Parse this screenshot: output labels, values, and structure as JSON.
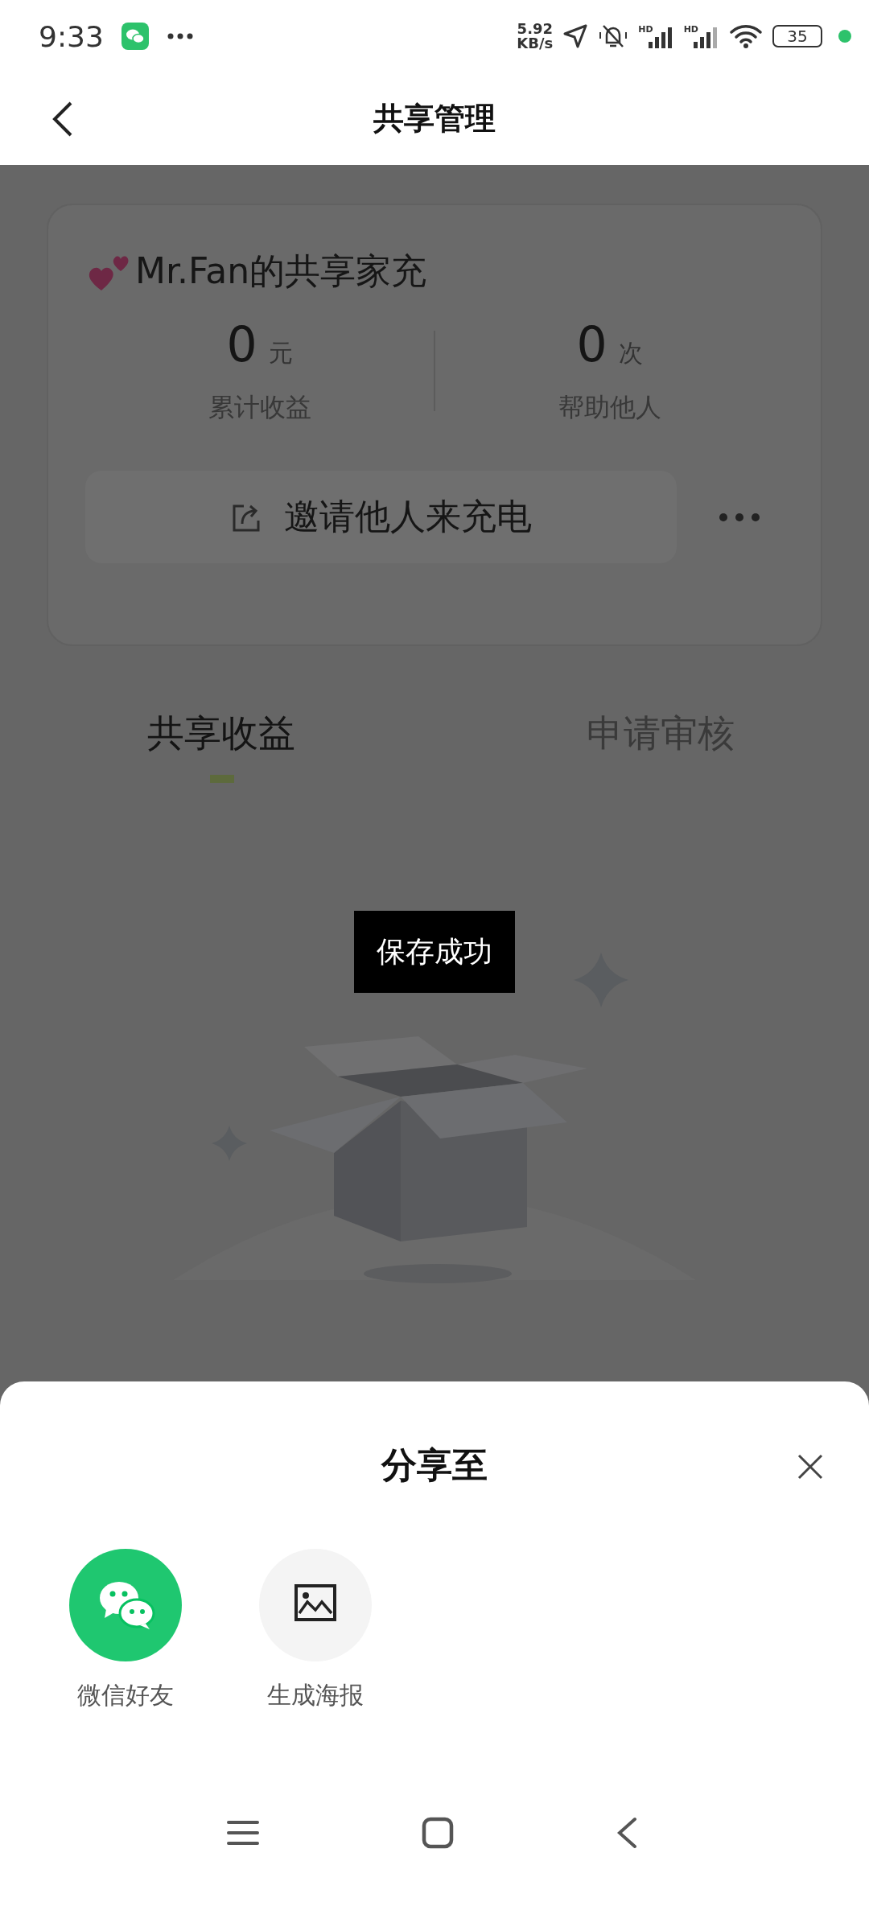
{
  "status_bar": {
    "time": "9:33",
    "net_speed_value": "5.92",
    "net_speed_unit": "KB/s",
    "signal_labels": [
      "HD",
      "HD"
    ],
    "battery": "35"
  },
  "nav": {
    "title": "共享管理"
  },
  "card": {
    "title": "Mr.Fan的共享家充",
    "stats": [
      {
        "value": "0",
        "unit": "元",
        "label": "累计收益"
      },
      {
        "value": "0",
        "unit": "次",
        "label": "帮助他人"
      }
    ],
    "invite_button": "邀请他人来充电"
  },
  "tabs": [
    {
      "label": "共享收益",
      "selected": true
    },
    {
      "label": "申请审核",
      "selected": false
    }
  ],
  "toast": "保存成功",
  "share_sheet": {
    "title": "分享至",
    "options": [
      {
        "label": "微信好友",
        "kind": "wechat"
      },
      {
        "label": "生成海报",
        "kind": "poster"
      }
    ]
  }
}
